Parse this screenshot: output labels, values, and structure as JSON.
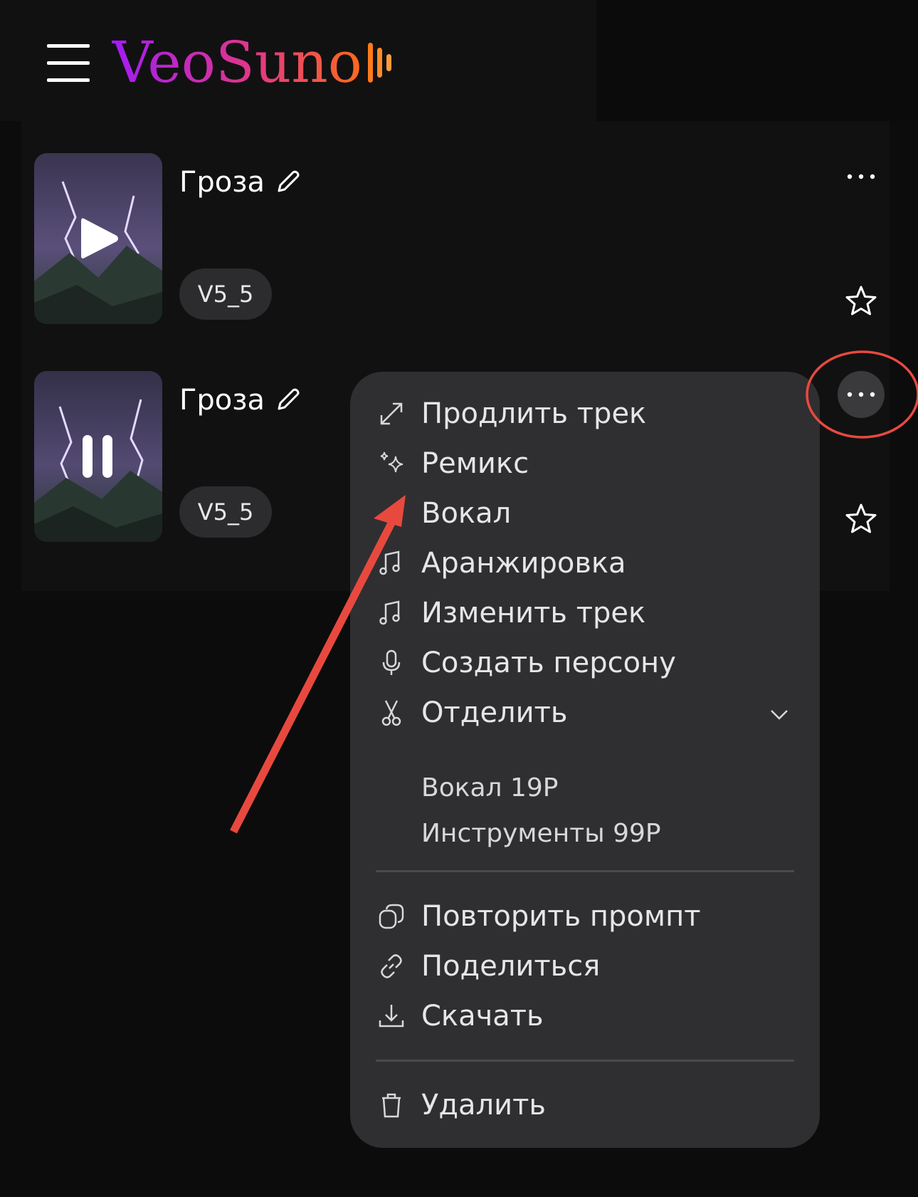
{
  "app": {
    "logo_text": "VeoSuno",
    "brand_colors": [
      "#a11cf5",
      "#e0368a",
      "#ff6a1a"
    ]
  },
  "tracks": [
    {
      "title": "Гроза",
      "version": "V5_5",
      "state": "play-icon"
    },
    {
      "title": "Гроза",
      "version": "V5_5",
      "state": "pause-icon"
    }
  ],
  "menu": {
    "items": [
      {
        "label": "Продлить трек",
        "icon": "expand-arrows-icon"
      },
      {
        "label": "Ремикс",
        "icon": "sparkles-icon"
      },
      {
        "label": "Вокал",
        "icon": "vocal-icon"
      },
      {
        "label": "Аранжировка",
        "icon": "music-note-icon"
      },
      {
        "label": "Изменить трек",
        "icon": "music-note-icon"
      },
      {
        "label": "Создать персону",
        "icon": "microphone-icon"
      },
      {
        "label": "Отделить",
        "icon": "scissors-icon"
      }
    ],
    "separate_options": [
      "Вокал 19Р",
      "Инструменты 99Р"
    ],
    "secondary": [
      {
        "label": "Повторить промпт",
        "icon": "copy-prompt-icon"
      },
      {
        "label": "Поделиться",
        "icon": "link-icon"
      },
      {
        "label": "Скачать",
        "icon": "download-icon"
      }
    ],
    "danger": {
      "label": "Удалить",
      "icon": "trash-icon"
    }
  },
  "annotation_color": "#e8493f"
}
